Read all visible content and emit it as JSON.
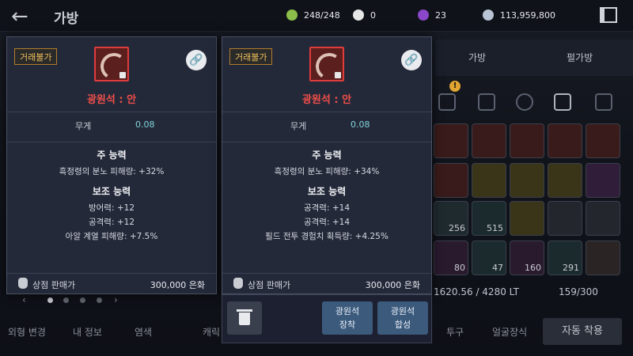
{
  "header": {
    "title": "가방",
    "currencies": [
      {
        "icon": "green-gem-icon",
        "value": "248/248",
        "color": "#8bbd4a"
      },
      {
        "icon": "pearl-icon",
        "value": "0",
        "color": "#e6e6e6"
      },
      {
        "icon": "purple-gem-icon",
        "value": "23",
        "color": "#8a47c9"
      },
      {
        "icon": "silver-coin-icon",
        "value": "113,959,800",
        "color": "#b9c4d4"
      }
    ]
  },
  "inventory": {
    "tabs": [
      {
        "label": "가방"
      },
      {
        "label": "펄가방"
      }
    ],
    "cell_counts": [
      "256",
      "515",
      "80",
      "47",
      "160",
      "291"
    ],
    "weight": "1620.56 / 4280 LT",
    "slots": "159/300",
    "badge": "!"
  },
  "bottom_bar": {
    "appearance": "외형 변경",
    "my_info": "내 정보",
    "dye": "염색",
    "char": "캐릭",
    "helmet": "투구",
    "face": "얼굴장식",
    "auto_wear": "자동 착용"
  },
  "pager": {
    "prev": "‹",
    "next": "›"
  },
  "cards": [
    {
      "trade_badge": "거래불가",
      "name": "광원석 : 안",
      "weight_label": "무게",
      "weight_value": "0.08",
      "main_title": "주 능력",
      "main_stats": [
        "흑정령의 분노 피해량: +32%"
      ],
      "sub_title": "보조 능력",
      "sub_stats": [
        "방어력: +12",
        "공격력: +12",
        "아알 계열 피해량: +7.5%"
      ],
      "sell_label": "상점 판매가",
      "sell_value": "300,000 은화"
    },
    {
      "trade_badge": "거래불가",
      "name": "광원석 : 안",
      "weight_label": "무게",
      "weight_value": "0.08",
      "main_title": "주 능력",
      "main_stats": [
        "흑정령의 분노 피해량: +34%"
      ],
      "sub_title": "보조 능력",
      "sub_stats": [
        "공격력: +14",
        "공격력: +14",
        "필드 전투 경험치 획득량: +4.25%"
      ],
      "sell_label": "상점 판매가",
      "sell_value": "300,000 은화"
    }
  ],
  "actions": {
    "equip_line1": "광원석",
    "equip_line2": "장착",
    "merge_line1": "광원석",
    "merge_line2": "합성"
  }
}
